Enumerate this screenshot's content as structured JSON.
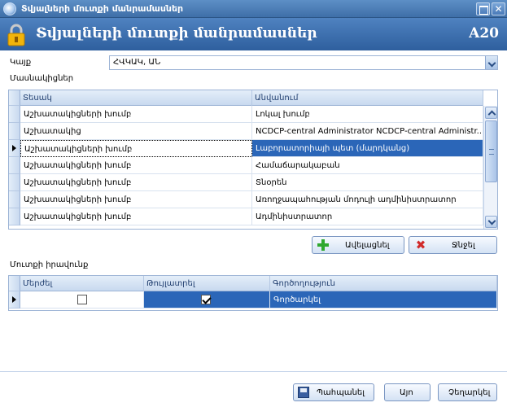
{
  "window": {
    "title": "Տվյալների մուտքի մանրամասներ",
    "close_glyph": "✕"
  },
  "header": {
    "title": "Տվյալների մուտքի մանրամասներ",
    "code": "A20"
  },
  "place": {
    "label": "Կայք",
    "value": "ՀՎԿԱԿ, ԱՆ"
  },
  "participants": {
    "label": "Մասնակիցներ",
    "columns": [
      "Տեսակ",
      "Անվանում"
    ],
    "rows": [
      [
        "Աշխատակիցների խումբ",
        "Լոկալ խումբ"
      ],
      [
        "Աշխատակից",
        "NCDCP-central Administrator NCDCP-central Administr..."
      ],
      [
        "Աշխատակիցների խումբ",
        "Լաբորատորիայի պետ (մարդկանց)"
      ],
      [
        "Աշխատակիցների խումբ",
        "Համաճարակաբան"
      ],
      [
        "Աշխատակիցների խումբ",
        "Տնօրեն"
      ],
      [
        "Աշխատակիցների խումբ",
        "Առողջապահության մոդուլի ադմինիստրատոր"
      ],
      [
        "Աշխատակիցների խումբ",
        "Ադմինիստրատոր"
      ]
    ],
    "selected_row": 2
  },
  "buttons": {
    "add": "Ավելացնել",
    "delete": "Ջնջել",
    "save": "Պահպանել",
    "ok": "Այո",
    "cancel": "Չեղարկել"
  },
  "access": {
    "label": "Մուտքի իրավունք",
    "columns": [
      "Մերժել",
      "Թույլատրել",
      "Գործողություն"
    ],
    "rows": [
      {
        "deny": false,
        "allow": true,
        "action": "Գործարկել"
      }
    ]
  },
  "colors": {
    "header_bg": "#2e5f9e",
    "selection": "#2b66b8",
    "accent_green": "#2fa82f",
    "accent_red": "#d12b2b"
  },
  "icons": [
    "app-icon",
    "lock-icon",
    "maximize-icon",
    "close-icon",
    "chevron-down-icon",
    "plus-icon",
    "x-icon",
    "save-icon"
  ]
}
